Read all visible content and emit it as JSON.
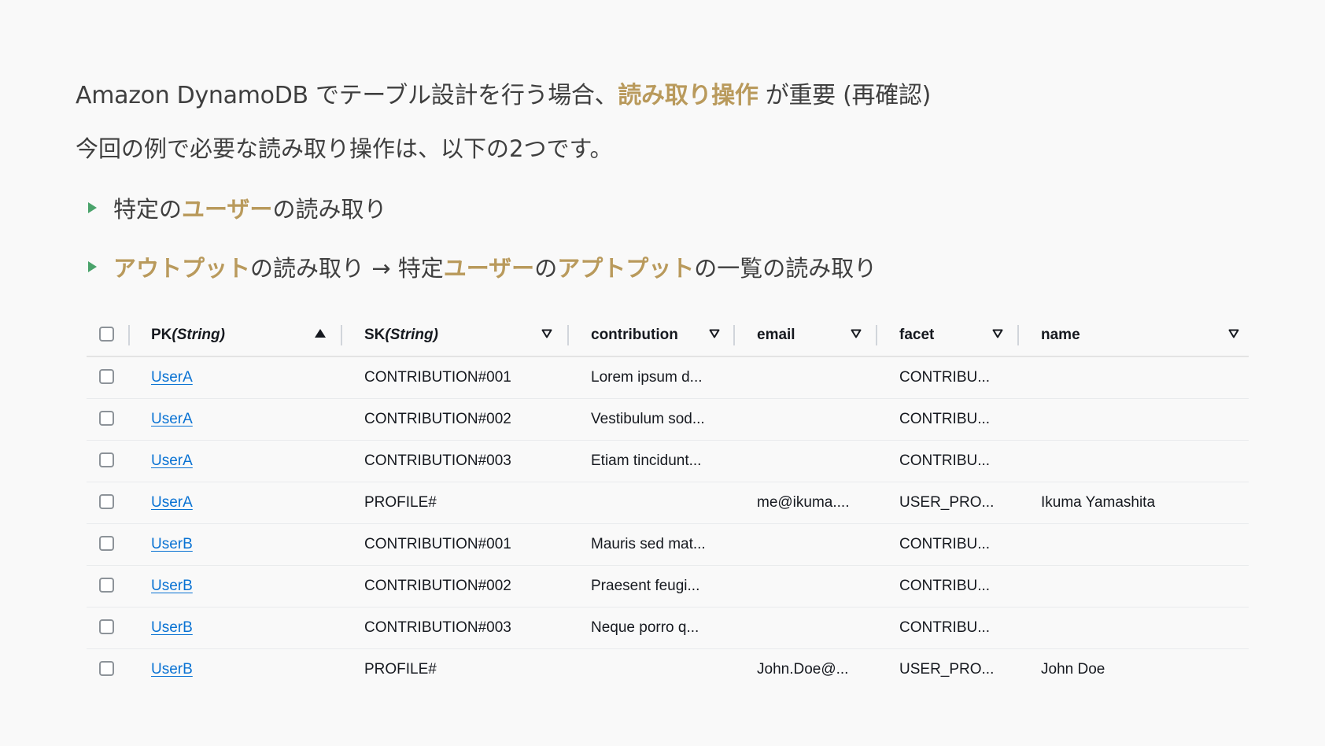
{
  "intro": {
    "line1_before": "Amazon DynamoDB でテーブル設計を行う場合、",
    "line1_highlight": "読み取り操作",
    "line1_after": " が重要 (再確認)",
    "line2": "今回の例で必要な読み取り操作は、以下の2つです。"
  },
  "bullets": [
    {
      "p1": "特定の ",
      "h1": "ユーザー",
      "p2": " の読み取り"
    },
    {
      "h1": "アウトプット",
      "p1": " の読み取り → 特定 ",
      "h2": "ユーザー",
      "p2": " の ",
      "h3": "アプトプット",
      "p3": " の一覧の読み取り"
    }
  ],
  "colors": {
    "highlight": "#b99a5c",
    "bullet_marker": "#4aa36b",
    "link": "#0972d3"
  },
  "table": {
    "headers": {
      "pk_label": "PK ",
      "pk_type": "(String)",
      "sk_label": "SK ",
      "sk_type": "(String)",
      "contribution": "contribution",
      "email": "email",
      "facet": "facet",
      "name": "name"
    },
    "sort": {
      "column": "PK",
      "direction": "ascending"
    },
    "rows": [
      {
        "pk": "UserA",
        "sk": "CONTRIBUTION#001",
        "contribution": "Lorem ipsum d...",
        "email": "",
        "facet": "CONTRIBU...",
        "name": ""
      },
      {
        "pk": "UserA",
        "sk": "CONTRIBUTION#002",
        "contribution": "Vestibulum sod...",
        "email": "",
        "facet": "CONTRIBU...",
        "name": ""
      },
      {
        "pk": "UserA",
        "sk": "CONTRIBUTION#003",
        "contribution": "Etiam tincidunt...",
        "email": "",
        "facet": "CONTRIBU...",
        "name": ""
      },
      {
        "pk": "UserA",
        "sk": "PROFILE#",
        "contribution": "",
        "email": "me@ikuma....",
        "facet": "USER_PRO...",
        "name": "Ikuma Yamashita"
      },
      {
        "pk": "UserB",
        "sk": "CONTRIBUTION#001",
        "contribution": "Mauris sed mat...",
        "email": "",
        "facet": "CONTRIBU...",
        "name": ""
      },
      {
        "pk": "UserB",
        "sk": "CONTRIBUTION#002",
        "contribution": "Praesent feugi...",
        "email": "",
        "facet": "CONTRIBU...",
        "name": ""
      },
      {
        "pk": "UserB",
        "sk": "CONTRIBUTION#003",
        "contribution": "Neque porro q...",
        "email": "",
        "facet": "CONTRIBU...",
        "name": ""
      },
      {
        "pk": "UserB",
        "sk": "PROFILE#",
        "contribution": "",
        "email": "John.Doe@...",
        "facet": "USER_PRO...",
        "name": "John Doe"
      }
    ]
  }
}
